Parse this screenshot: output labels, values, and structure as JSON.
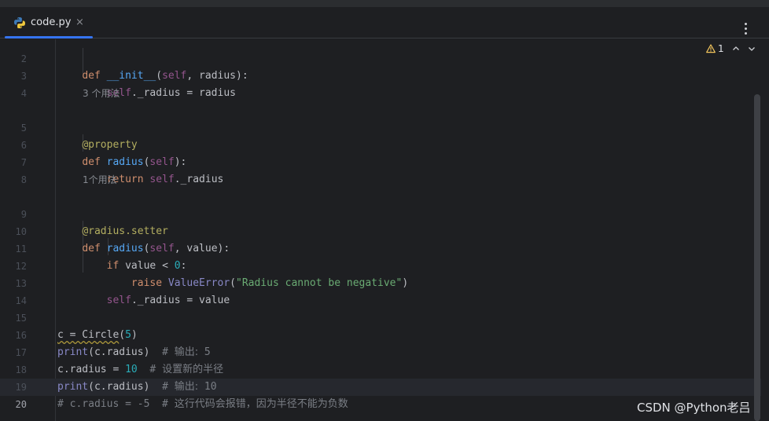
{
  "tab": {
    "filename": "code.py",
    "close_glyph": "×"
  },
  "inspections": {
    "warning_count": "1"
  },
  "watermark": "CSDN @Python老吕",
  "current_line": "20",
  "usage_hints": {
    "radius_getter": "3 个用法",
    "radius_setter": "1个用法"
  },
  "lines": [
    {
      "n": "2",
      "code": "    def __init__(self, radius):"
    },
    {
      "n": "3",
      "code": "        self._radius = radius"
    },
    {
      "n": "4",
      "code": ""
    },
    {
      "n": "5",
      "code": "    @property"
    },
    {
      "n": "6",
      "code": "    def radius(self):"
    },
    {
      "n": "7",
      "code": "        return self._radius"
    },
    {
      "n": "8",
      "code": ""
    },
    {
      "n": "9",
      "code": "    @radius.setter"
    },
    {
      "n": "10",
      "code": "    def radius(self, value):"
    },
    {
      "n": "11",
      "code": "        if value < 0:"
    },
    {
      "n": "12",
      "code": "            raise ValueError(\"Radius cannot be negative\")"
    },
    {
      "n": "13",
      "code": "        self._radius = value"
    },
    {
      "n": "14",
      "code": ""
    },
    {
      "n": "15",
      "code": "c = Circle(5)"
    },
    {
      "n": "16",
      "code": "print(c.radius)  # 输出: 5"
    },
    {
      "n": "17",
      "code": "c.radius = 10  # 设置新的半径"
    },
    {
      "n": "18",
      "code": "print(c.radius)  # 输出: 10"
    },
    {
      "n": "19",
      "code": "# c.radius = -5  # 这行代码会报错，因为半径不能为负数"
    },
    {
      "n": "20",
      "code": ""
    }
  ],
  "colors": {
    "background": "#1e1f22",
    "keyword": "#cf8e6d",
    "function": "#56a8f5",
    "self": "#94558d",
    "decorator": "#b3ae60",
    "number": "#2aacb8",
    "string": "#6aab73",
    "builtin": "#8888c6",
    "comment": "#7a7e85",
    "tab_accent": "#3574f0",
    "warning": "#f2c55c"
  },
  "icons": [
    "python-file-icon",
    "close-icon",
    "more-options-icon",
    "warning-icon",
    "chevron-up-icon",
    "chevron-down-icon"
  ]
}
